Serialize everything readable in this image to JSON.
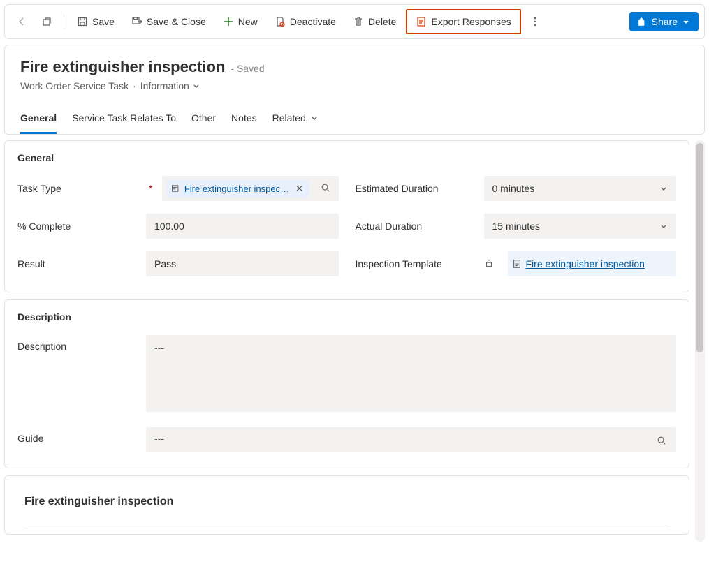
{
  "toolbar": {
    "save": "Save",
    "save_close": "Save & Close",
    "new": "New",
    "deactivate": "Deactivate",
    "delete": "Delete",
    "export_responses": "Export Responses",
    "share": "Share"
  },
  "header": {
    "title": "Fire extinguisher inspection",
    "status": "- Saved",
    "entity": "Work Order Service Task",
    "form_name": "Information"
  },
  "tabs": {
    "general": "General",
    "relates": "Service Task Relates To",
    "other": "Other",
    "notes": "Notes",
    "related": "Related"
  },
  "general_section": {
    "heading": "General",
    "labels": {
      "task_type": "Task Type",
      "percent_complete": "% Complete",
      "result": "Result",
      "est_duration": "Estimated Duration",
      "actual_duration": "Actual Duration",
      "inspection_template": "Inspection Template"
    },
    "values": {
      "task_type_link": "Fire extinguisher inspection",
      "percent_complete": "100.00",
      "result": "Pass",
      "est_duration": "0 minutes",
      "actual_duration": "15 minutes",
      "inspection_template_link": "Fire extinguisher inspection"
    }
  },
  "description_section": {
    "heading": "Description",
    "labels": {
      "description": "Description",
      "guide": "Guide"
    },
    "values": {
      "description_placeholder": "---",
      "guide_placeholder": "---"
    }
  },
  "detail_section": {
    "title": "Fire extinguisher inspection"
  }
}
